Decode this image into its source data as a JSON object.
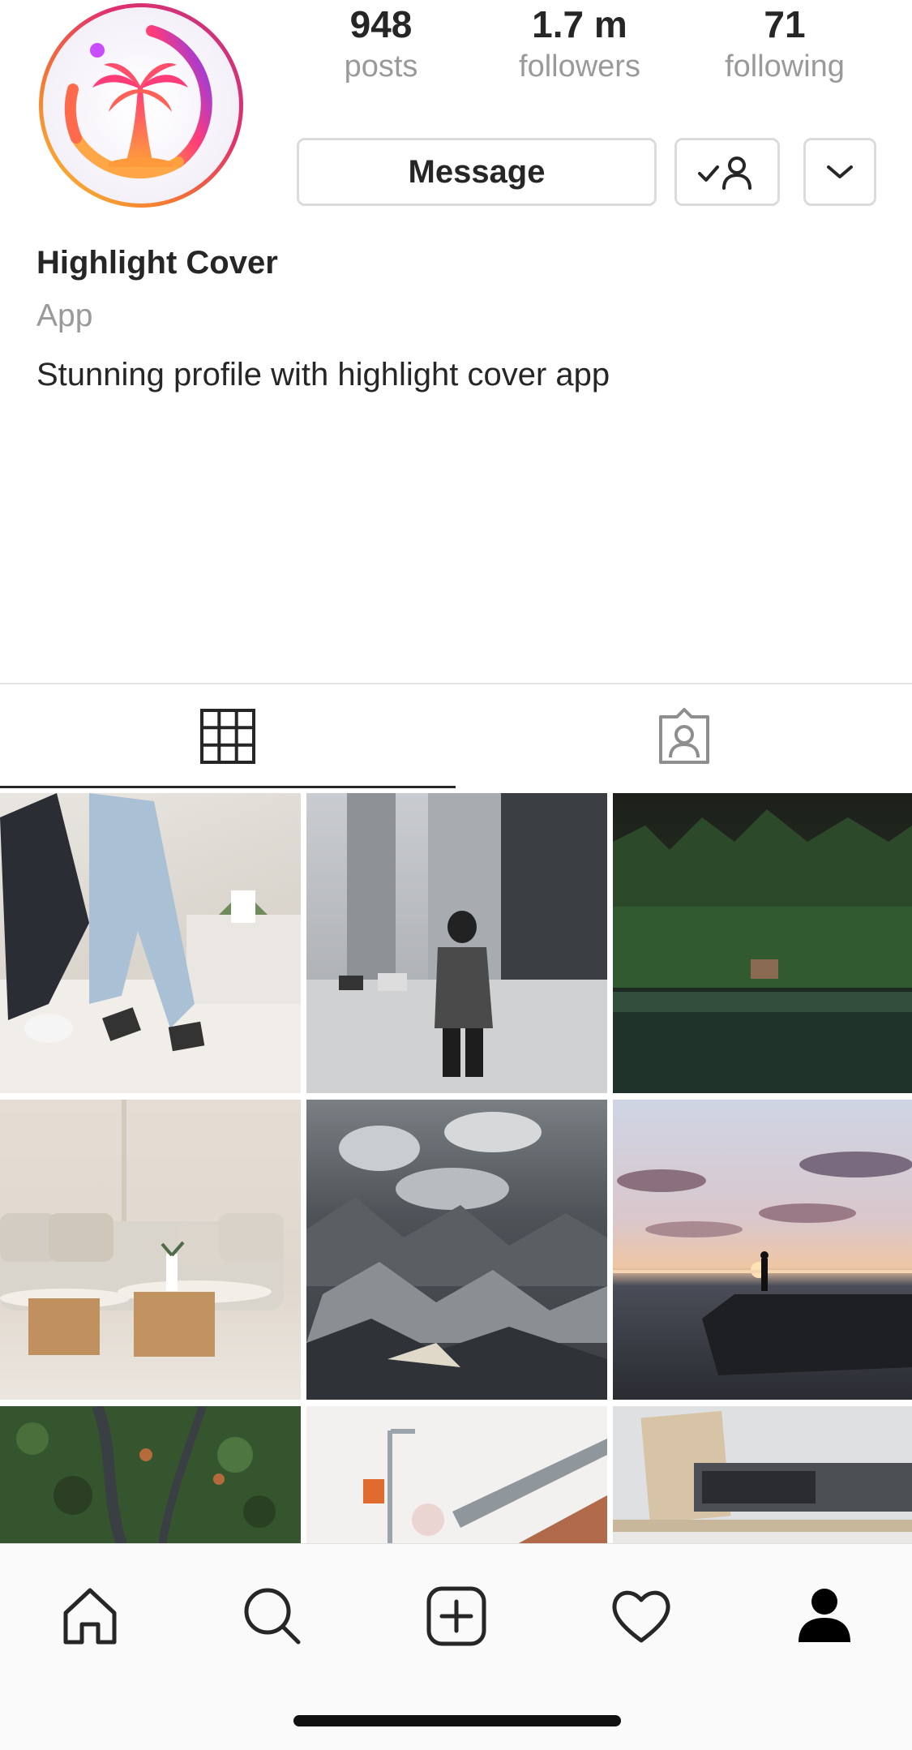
{
  "profile": {
    "name": "Highlight Cover",
    "category": "App",
    "bio": "Stunning profile with highlight cover app"
  },
  "stats": [
    {
      "value": "948",
      "label": "posts"
    },
    {
      "value": "1.7 m",
      "label": "followers"
    },
    {
      "value": "71",
      "label": "following"
    }
  ],
  "actions": {
    "message_label": "Message",
    "follow_icon": "following-check-person-icon",
    "more_icon": "chevron-down-icon"
  },
  "tabs": [
    {
      "icon": "grid-icon",
      "selected": true
    },
    {
      "icon": "tagged-person-icon",
      "selected": false
    }
  ],
  "grid": [
    {
      "scene": "two people jumping on a bed"
    },
    {
      "scene": "man with camera on city street"
    },
    {
      "scene": "forest lake with cabin"
    },
    {
      "scene": "beige sofa with round coffee tables"
    },
    {
      "scene": "aerial snowy mountains"
    },
    {
      "scene": "sunset sea with person on rock"
    },
    {
      "scene": "aerial forest with road"
    },
    {
      "scene": "street lamp and stairway"
    },
    {
      "scene": "record player on shelf"
    }
  ],
  "bottom_nav": [
    {
      "icon": "home-icon"
    },
    {
      "icon": "search-icon"
    },
    {
      "icon": "new-post-icon"
    },
    {
      "icon": "activity-heart-icon"
    },
    {
      "icon": "profile-icon",
      "active": true
    }
  ],
  "colors": {
    "text": "#262626",
    "secondary": "#9a9a9a",
    "border": "#dbdbdb",
    "avatar_gradient": [
      "#f58529",
      "#dd2a7b",
      "#8134af",
      "#515bd4"
    ]
  }
}
